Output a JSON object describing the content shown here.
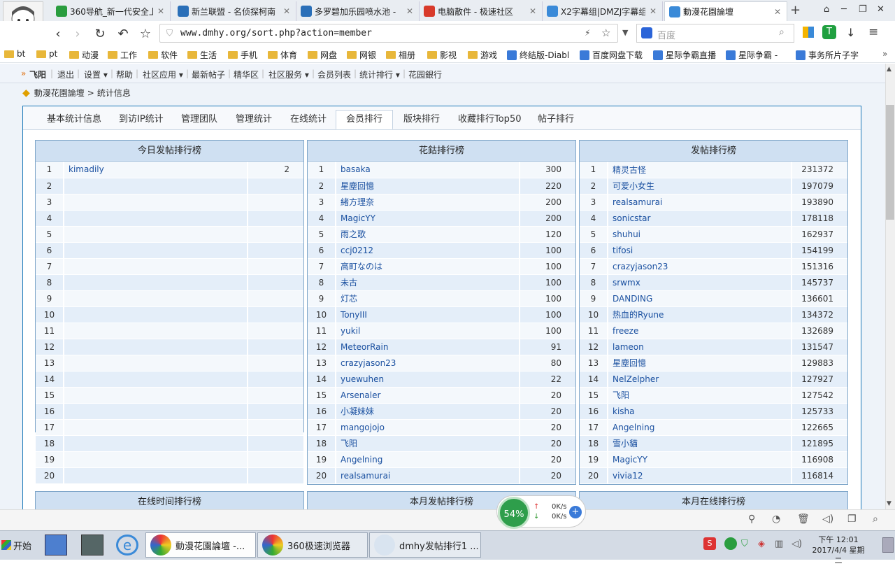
{
  "browser": {
    "tabs": [
      {
        "title": "360导航_新一代安全上",
        "color": "#2a9d3f"
      },
      {
        "title": "新兰联盟 - 名侦探柯南",
        "color": "#2a6fb8"
      },
      {
        "title": "多罗碧加乐园喷水池 -",
        "color": "#2a6fb8"
      },
      {
        "title": "电脑散件 - 极速社区",
        "color": "#d83a2a"
      },
      {
        "title": "X2字幕组|DMZJ字幕组",
        "color": "#3a8ad8"
      },
      {
        "title": "動漫花園論壇",
        "color": "#3a8ad8"
      }
    ],
    "url": "www.dmhy.org/sort.php?action=member",
    "search_placeholder": "百度",
    "bookmarks": [
      {
        "label": "bt",
        "type": "folder"
      },
      {
        "label": "pt",
        "type": "folder"
      },
      {
        "label": "动漫",
        "type": "folder"
      },
      {
        "label": "工作",
        "type": "folder"
      },
      {
        "label": "软件",
        "type": "folder"
      },
      {
        "label": "生活",
        "type": "folder"
      },
      {
        "label": "手机",
        "type": "folder"
      },
      {
        "label": "体育",
        "type": "folder"
      },
      {
        "label": "网盘",
        "type": "folder"
      },
      {
        "label": "网银",
        "type": "folder"
      },
      {
        "label": "相册",
        "type": "folder"
      },
      {
        "label": "影视",
        "type": "folder"
      },
      {
        "label": "游戏",
        "type": "folder"
      },
      {
        "label": "终结版-Diabl",
        "type": "link"
      },
      {
        "label": "百度网盘下载",
        "type": "link"
      },
      {
        "label": "星际争霸直播",
        "type": "link"
      },
      {
        "label": "星际争霸 -",
        "type": "link"
      },
      {
        "label": "事务所片子字",
        "type": "link"
      }
    ],
    "new_tab": "+"
  },
  "site_nav": {
    "user": "飞阳",
    "logout": "退出",
    "settings": "设置",
    "help": "帮助",
    "apps": "社区应用",
    "latest": "最新帖子",
    "elite": "精华区",
    "services": "社区服务",
    "members": "会员列表",
    "stats": "统计排行",
    "bank": "花园銀行"
  },
  "breadcrumb": {
    "forum": "動漫花園論壇",
    "sep": ">",
    "page": "统计信息"
  },
  "page_tabs": [
    "基本统计信息",
    "到访IP统计",
    "管理团队",
    "管理统计",
    "在线统计",
    "会员排行",
    "版块排行",
    "收藏排行Top50",
    "帖子排行"
  ],
  "active_tab": "会员排行",
  "rankings": [
    {
      "title": "今日发帖排行榜",
      "rows": [
        {
          "n": "1",
          "u": "kimadily",
          "v": "2"
        },
        {
          "n": "2",
          "u": "",
          "v": ""
        },
        {
          "n": "3",
          "u": "",
          "v": ""
        },
        {
          "n": "4",
          "u": "",
          "v": ""
        },
        {
          "n": "5",
          "u": "",
          "v": ""
        },
        {
          "n": "6",
          "u": "",
          "v": ""
        },
        {
          "n": "7",
          "u": "",
          "v": ""
        },
        {
          "n": "8",
          "u": "",
          "v": ""
        },
        {
          "n": "9",
          "u": "",
          "v": ""
        },
        {
          "n": "10",
          "u": "",
          "v": ""
        },
        {
          "n": "11",
          "u": "",
          "v": ""
        },
        {
          "n": "12",
          "u": "",
          "v": ""
        },
        {
          "n": "13",
          "u": "",
          "v": ""
        },
        {
          "n": "14",
          "u": "",
          "v": ""
        },
        {
          "n": "15",
          "u": "",
          "v": ""
        },
        {
          "n": "16",
          "u": "",
          "v": ""
        },
        {
          "n": "17",
          "u": "",
          "v": ""
        },
        {
          "n": "18",
          "u": "",
          "v": ""
        },
        {
          "n": "19",
          "u": "",
          "v": ""
        },
        {
          "n": "20",
          "u": "",
          "v": ""
        }
      ]
    },
    {
      "title": "花鈷排行榜",
      "rows": [
        {
          "n": "1",
          "u": "basaka",
          "v": "300"
        },
        {
          "n": "2",
          "u": "星塵回憶",
          "v": "220"
        },
        {
          "n": "3",
          "u": "緒方理奈",
          "v": "200"
        },
        {
          "n": "4",
          "u": "MagicYY",
          "v": "200"
        },
        {
          "n": "5",
          "u": "雨之歌",
          "v": "120"
        },
        {
          "n": "6",
          "u": "ccj0212",
          "v": "100"
        },
        {
          "n": "7",
          "u": "高町なのは",
          "v": "100"
        },
        {
          "n": "8",
          "u": "未古",
          "v": "100"
        },
        {
          "n": "9",
          "u": "灯芯",
          "v": "100"
        },
        {
          "n": "10",
          "u": "TonyIII",
          "v": "100"
        },
        {
          "n": "11",
          "u": "yukil",
          "v": "100"
        },
        {
          "n": "12",
          "u": "MeteorRain",
          "v": "91"
        },
        {
          "n": "13",
          "u": "crazyjason23",
          "v": "80"
        },
        {
          "n": "14",
          "u": "yuewuhen",
          "v": "22"
        },
        {
          "n": "15",
          "u": "Arsenaler",
          "v": "20"
        },
        {
          "n": "16",
          "u": "小凝妹妹",
          "v": "20"
        },
        {
          "n": "17",
          "u": "mangojojo",
          "v": "20"
        },
        {
          "n": "18",
          "u": "飞阳",
          "v": "20"
        },
        {
          "n": "19",
          "u": "Angelning",
          "v": "20"
        },
        {
          "n": "20",
          "u": "realsamurai",
          "v": "20"
        }
      ]
    },
    {
      "title": "发帖排行榜",
      "rows": [
        {
          "n": "1",
          "u": "精灵古怪",
          "v": "231372"
        },
        {
          "n": "2",
          "u": "可爱小女生",
          "v": "197079"
        },
        {
          "n": "3",
          "u": "realsamurai",
          "v": "193890"
        },
        {
          "n": "4",
          "u": "sonicstar",
          "v": "178118"
        },
        {
          "n": "5",
          "u": "shuhui",
          "v": "162937"
        },
        {
          "n": "6",
          "u": "tifosi",
          "v": "154199"
        },
        {
          "n": "7",
          "u": "crazyjason23",
          "v": "151316"
        },
        {
          "n": "8",
          "u": "srwmx",
          "v": "145737"
        },
        {
          "n": "9",
          "u": "DANDING",
          "v": "136601"
        },
        {
          "n": "10",
          "u": "热血的Ryune",
          "v": "134372"
        },
        {
          "n": "11",
          "u": "freeze",
          "v": "132689"
        },
        {
          "n": "12",
          "u": "lameon",
          "v": "131547"
        },
        {
          "n": "13",
          "u": "星塵回憶",
          "v": "129883"
        },
        {
          "n": "14",
          "u": "NelZelpher",
          "v": "127927"
        },
        {
          "n": "15",
          "u": "飞阳",
          "v": "127542"
        },
        {
          "n": "16",
          "u": "kisha",
          "v": "125733"
        },
        {
          "n": "17",
          "u": "Angelning",
          "v": "122665"
        },
        {
          "n": "18",
          "u": "雪小貓",
          "v": "121895"
        },
        {
          "n": "19",
          "u": "MagicYY",
          "v": "116908"
        },
        {
          "n": "20",
          "u": "vivia12",
          "v": "116814"
        }
      ]
    }
  ],
  "next_rankings": [
    "在线时间排行榜",
    "本月发帖排行榜",
    "本月在线排行榜"
  ],
  "net_widget": {
    "percent": "54%",
    "up": "0K/s",
    "down": "0K/s"
  },
  "taskbar": {
    "start": "开始",
    "tasks": [
      "動漫花園論壇 -...",
      "360极速浏览器",
      "dmhy发帖排行1 ..."
    ],
    "time": "下午 12:01",
    "date": "2017/4/4 星期二"
  }
}
